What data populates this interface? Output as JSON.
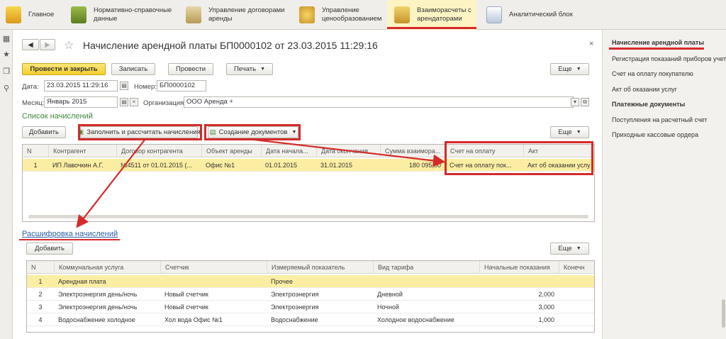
{
  "topbar": {
    "items": [
      {
        "label": "Главное"
      },
      {
        "label": "Нормативно-справочные данные"
      },
      {
        "label": "Управление договорами аренды"
      },
      {
        "label": "Управление ценообразованием"
      },
      {
        "label": "Взаиморасчеты с арендаторами"
      },
      {
        "label": "Аналитический блок"
      }
    ]
  },
  "doc": {
    "title": "Начисление арендной платы БП0000102 от 23.03.2015 11:29:16",
    "buttons": {
      "post_close": "Провести и закрыть",
      "save": "Записать",
      "post": "Провести",
      "print": "Печать",
      "more": "Еще"
    },
    "date_label": "Дата:",
    "date_value": "23.03.2015 11:29:16",
    "number_label": "Номер:",
    "number_value": "БП0000102",
    "month_label": "Месяц:",
    "month_value": "Январь 2015",
    "org_label": "Организация:",
    "org_value": "ООО Аренда +"
  },
  "charges": {
    "section": "Список начислений",
    "add": "Добавить",
    "fill": "Заполнить и рассчитать начисления",
    "create_docs": "Создание документов",
    "more": "Еще",
    "columns": [
      "N",
      "Контрагент",
      "Договор контрагента",
      "Объект аренды",
      "Дата начала...",
      "Дата окончания",
      "Сумма взаимора...",
      "Счет на оплату",
      "Акт"
    ],
    "rows": [
      [
        "1",
        "ИП Лавочкин А.Г.",
        "№4511 от 01.01.2015 (...",
        "Офис №1",
        "01.01.2015",
        "31.01.2015",
        "180 095,00",
        "Счет на оплату пок...",
        "Акт об оказании услу"
      ]
    ]
  },
  "details": {
    "section": "Расшифровка начислений",
    "add": "Добавить",
    "more": "Еще",
    "columns": [
      "N",
      "Коммунальная услуга",
      "Счетчик",
      "Измеряемый показатель",
      "Вид тарифа",
      "Начальные показания",
      "Конечн"
    ],
    "rows": [
      [
        "1",
        "Арендная плата",
        "",
        "Прочее",
        "",
        "",
        ""
      ],
      [
        "2",
        "Электроэнергия день/ночь",
        "Новый счетчик",
        "Электроэнергия",
        "Дневной",
        "2,000",
        ""
      ],
      [
        "3",
        "Электроэнергия день/ночь",
        "Новый счетчик",
        "Электроэнергия",
        "Ночной",
        "3,000",
        ""
      ],
      [
        "4",
        "Водоснабжение холодное",
        "Хол вода Офис №1",
        "Водоснабжение",
        "Холодное водоснабжение",
        "1,000",
        ""
      ]
    ]
  },
  "rpanel": {
    "items": [
      "Начисление арендной платы",
      "Регистрация показаний приборов учета",
      "Счет на оплату покупателю",
      "Акт об оказании услуг"
    ],
    "group": "Платежные документы",
    "group_items": [
      "Поступления на расчетный счет",
      "Приходные кассовые ордера"
    ]
  },
  "colors": {
    "accent_red": "#d42a2a",
    "selected_row": "#fbeea2",
    "section_green": "#3e8a3e",
    "primary_button": "#f3cf2b"
  }
}
